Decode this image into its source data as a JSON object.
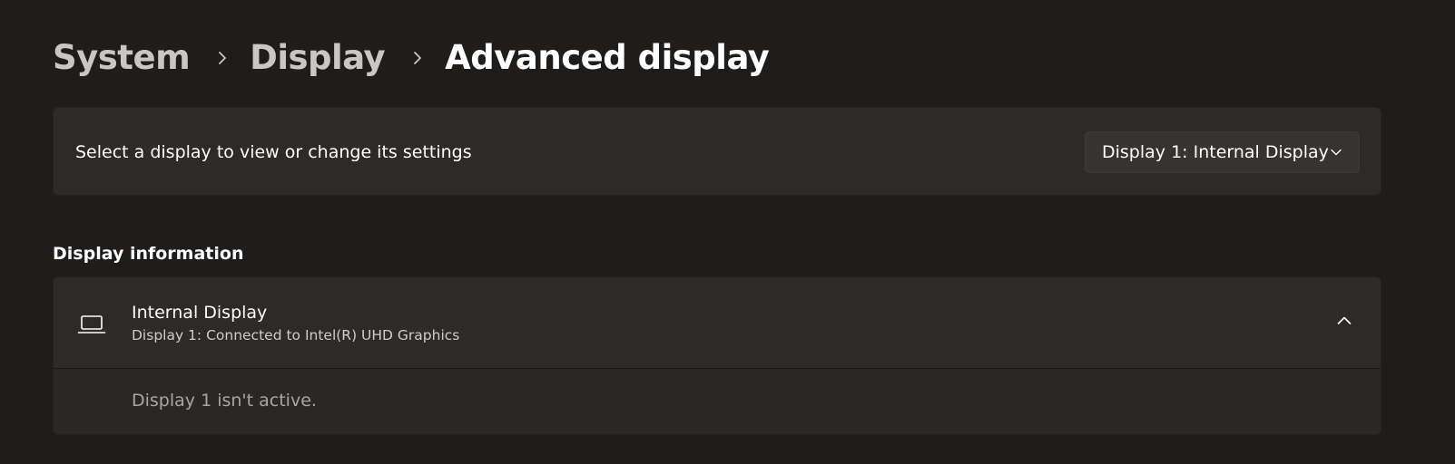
{
  "breadcrumb": {
    "items": [
      "System",
      "Display",
      "Advanced display"
    ]
  },
  "display_selector": {
    "label": "Select a display to view or change its settings",
    "selected": "Display 1: Internal Display"
  },
  "display_information": {
    "section_title": "Display information",
    "title": "Internal Display",
    "subtitle": "Display 1: Connected to Intel(R) UHD Graphics",
    "status_text": "Display 1 isn't active.",
    "expanded": true
  },
  "icons": {
    "breadcrumb_separator": "chevron-right-icon",
    "dropdown": "chevron-down-icon",
    "display": "laptop-icon",
    "collapse": "chevron-up-icon"
  },
  "colors": {
    "background": "#1f1d1b",
    "card": "#2d2a28",
    "text": "#ffffff",
    "secondary_text": "#a8a6a4"
  }
}
